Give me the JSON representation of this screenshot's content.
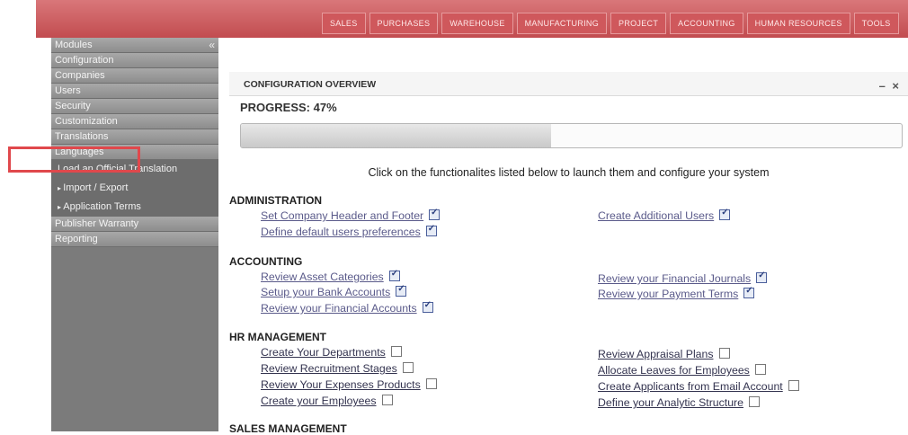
{
  "topnav": [
    "SALES",
    "PURCHASES",
    "WAREHOUSE",
    "MANUFACTURING",
    "PROJECT",
    "ACCOUNTING",
    "HUMAN RESOURCES",
    "TOOLS"
  ],
  "sidebar": {
    "items": [
      {
        "label": "Modules",
        "collapse": "«"
      },
      {
        "label": "Configuration"
      },
      {
        "label": "Companies"
      },
      {
        "label": "Users"
      },
      {
        "label": "Security"
      },
      {
        "label": "Customization"
      },
      {
        "label": "Translations"
      },
      {
        "label": "Languages"
      }
    ],
    "subitems": [
      {
        "label": "Load an Official Translation",
        "arrow": false
      },
      {
        "label": "Import / Export",
        "arrow": true
      },
      {
        "label": "Application Terms",
        "arrow": true
      }
    ],
    "bottom_items": [
      {
        "label": "Publisher Warranty"
      },
      {
        "label": "Reporting"
      }
    ]
  },
  "panel": {
    "title": "CONFIGURATION OVERVIEW",
    "tools": "– ×",
    "progress_label": "PROGRESS: 47%",
    "progress_value": 0.47,
    "hint": "Click on the functionalites listed below to launch them and configure your system"
  },
  "sections": {
    "administration": "ADMINISTRATION",
    "accounting": "ACCOUNTING",
    "hr": "HR MANAGEMENT",
    "sales": "SALES MANAGEMENT"
  },
  "links": {
    "set_company_header": {
      "label": "Set Company Header and Footer",
      "checked": true
    },
    "create_additional_users": {
      "label": "Create Additional Users",
      "checked": true
    },
    "define_default_prefs": {
      "label": "Define default users preferences",
      "checked": true
    },
    "review_asset_categories": {
      "label": "Review Asset Categories",
      "checked": true
    },
    "review_financial_journals": {
      "label": "Review your Financial Journals",
      "checked": true
    },
    "setup_bank_accounts": {
      "label": "Setup your Bank Accounts",
      "checked": true
    },
    "review_payment_terms": {
      "label": "Review your Payment Terms",
      "checked": true
    },
    "review_financial_accounts": {
      "label": "Review your Financial Accounts",
      "checked": true
    },
    "create_departments": {
      "label": "Create Your Departments",
      "checked": false
    },
    "review_appraisal_plans": {
      "label": "Review Appraisal Plans",
      "checked": false
    },
    "review_recruitment_stages": {
      "label": "Review Recruitment Stages",
      "checked": false
    },
    "allocate_leaves": {
      "label": "Allocate Leaves for Employees",
      "checked": false
    },
    "review_expenses_products": {
      "label": "Review Your Expenses Products",
      "checked": false
    },
    "create_applicants": {
      "label": "Create Applicants from Email Account",
      "checked": false
    },
    "create_employees": {
      "label": "Create your Employees",
      "checked": false
    },
    "define_analytic_structure": {
      "label": "Define your Analytic Structure",
      "checked": false
    }
  }
}
